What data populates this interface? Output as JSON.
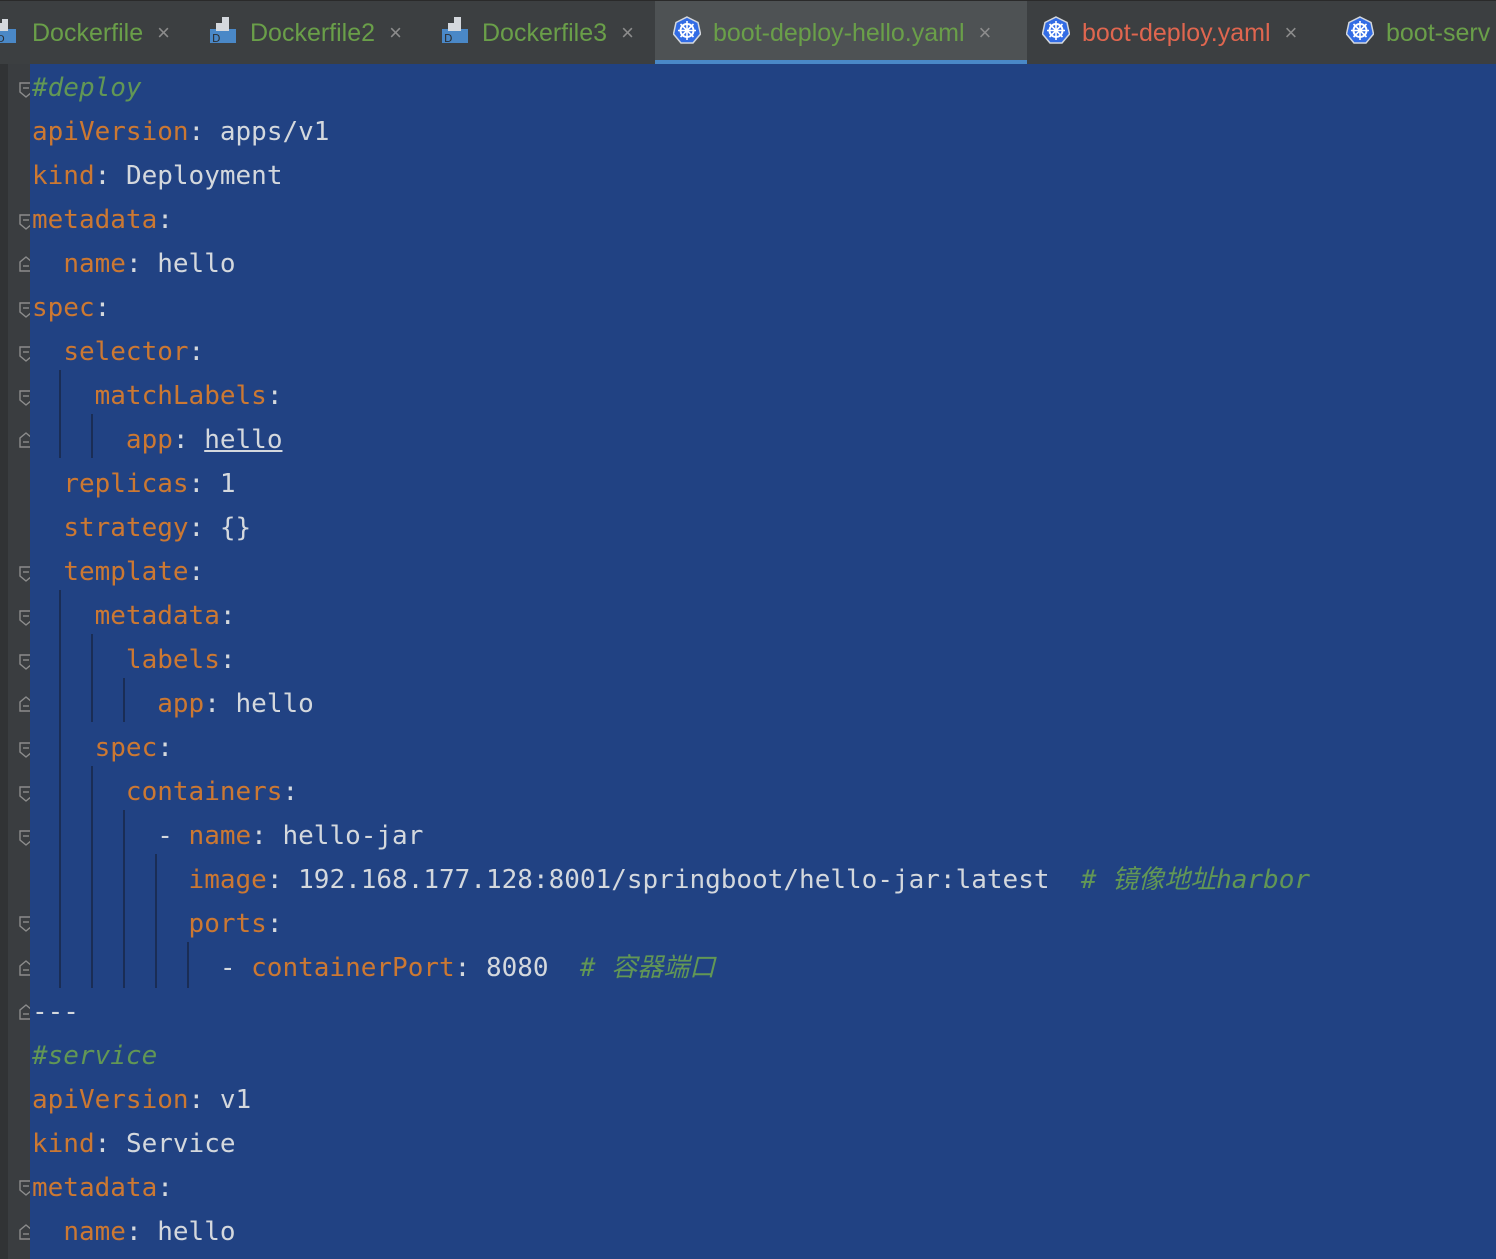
{
  "tabs": [
    {
      "label": "Dockerfile",
      "icon": "dockerfile-icon",
      "color": "#6a9f49",
      "active": false
    },
    {
      "label": "Dockerfile2",
      "icon": "dockerfile-icon",
      "color": "#6a9f49",
      "active": false
    },
    {
      "label": "Dockerfile3",
      "icon": "dockerfile-icon",
      "color": "#6a9f49",
      "active": false
    },
    {
      "label": "boot-deploy-hello.yaml",
      "icon": "kubernetes-icon",
      "color": "#6a9f49",
      "active": true
    },
    {
      "label": "boot-deploy.yaml",
      "icon": "kubernetes-icon",
      "color": "#e0664f",
      "active": false
    },
    {
      "label": "boot-serv",
      "icon": "kubernetes-icon",
      "color": "#6a9f49",
      "active": false
    }
  ],
  "close_glyph": "×",
  "code": {
    "l1": "#deploy",
    "l2_k": "apiVersion",
    "l2_v": "apps/v1",
    "l3_k": "kind",
    "l3_v": "Deployment",
    "l4_k": "metadata",
    "l5_k": "name",
    "l5_v": "hello",
    "l6_k": "spec",
    "l7_k": "selector",
    "l8_k": "matchLabels",
    "l9_k": "app",
    "l9_v": "hello",
    "l10_k": "replicas",
    "l10_v": "1",
    "l11_k": "strategy",
    "l11_v": "{}",
    "l12_k": "template",
    "l13_k": "metadata",
    "l14_k": "labels",
    "l15_k": "app",
    "l15_v": "hello",
    "l16_k": "spec",
    "l17_k": "containers",
    "l18_k": "name",
    "l18_v": "hello-jar",
    "l19_k": "image",
    "l19_v": "192.168.177.128:8001/springboot/hello-jar:latest",
    "l19_c": "# 镜像地址harbor",
    "l20_k": "ports",
    "l21_k": "containerPort",
    "l21_v": "8080",
    "l21_c": "# 容器端口",
    "l22": "---",
    "l23": "#service",
    "l24_k": "apiVersion",
    "l24_v": "v1",
    "l25_k": "kind",
    "l25_v": "Service",
    "l26_k": "metadata",
    "l27_k": "name",
    "l27_v": "hello"
  },
  "colors": {
    "selection_bg": "#214283",
    "key": "#cc7832",
    "value": "#d4d8dd",
    "comment": "#629755",
    "active_tab_underline": "#4a88c7"
  }
}
